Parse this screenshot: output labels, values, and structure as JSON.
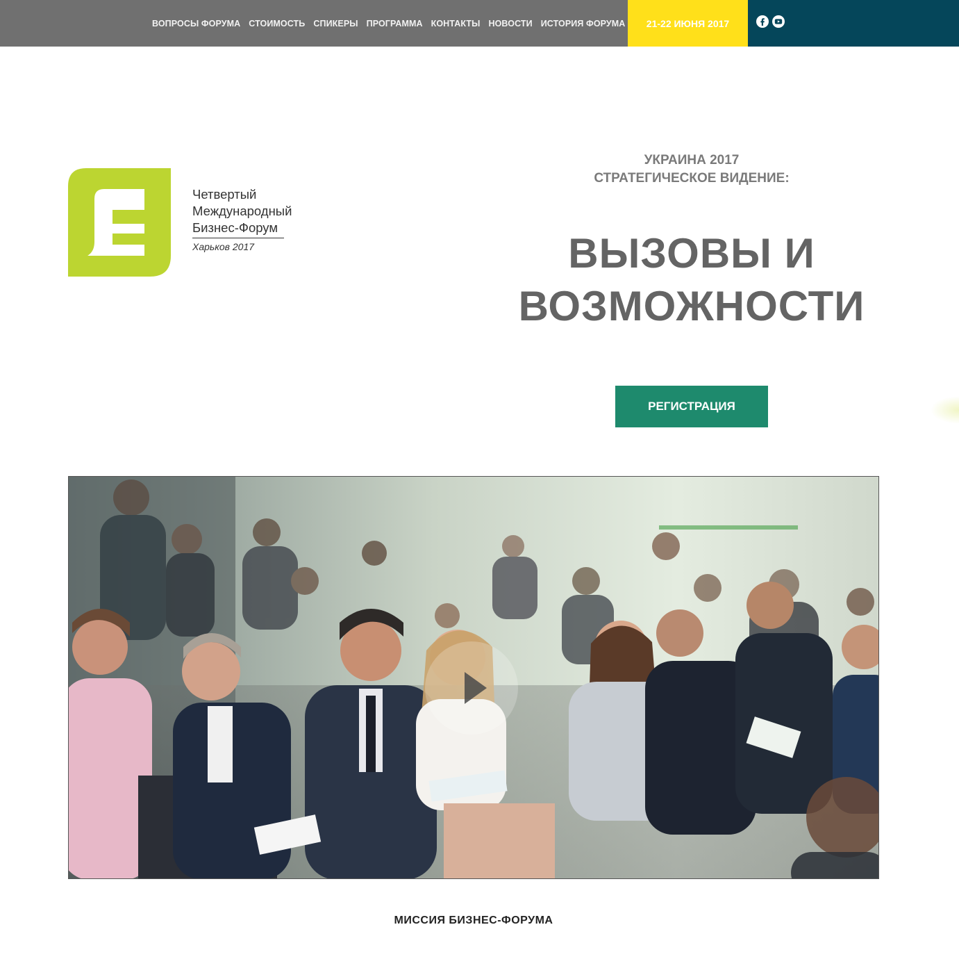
{
  "nav": {
    "items": [
      {
        "label": "ВОПРОСЫ ФОРУМА"
      },
      {
        "label": "СТОИМОСТЬ"
      },
      {
        "label": "СПИКЕРЫ"
      },
      {
        "label": "ПРОГРАММА"
      },
      {
        "label": "КОНТАКТЫ"
      },
      {
        "label": "НОВОСТИ"
      },
      {
        "label": "ИСТОРИЯ ФОРУМА"
      }
    ],
    "date": "21-22 ИЮНЯ 2017",
    "social": [
      "facebook-icon",
      "youtube-icon"
    ]
  },
  "logo": {
    "line1": "Четвертый",
    "line2": "Международный",
    "line3": "Бизнес-Форум",
    "city": "Харьков 2017"
  },
  "hero": {
    "subtitle_line1": "УКРАИНА 2017",
    "subtitle_line2": "СТРАТЕГИЧЕСКОЕ ВИДЕНИЕ:",
    "title_line1": "ВЫЗОВЫ И",
    "title_line2": "ВОЗМОЖНОСТИ",
    "register_label": "РЕГИСТРАЦИЯ"
  },
  "video": {
    "play_icon": "play-icon"
  },
  "mission": {
    "heading": "МИССИЯ БИЗНЕС-ФОРУМА"
  },
  "colors": {
    "topbar": "#707070",
    "date_bg": "#ffe01a",
    "social_bg": "#05465a",
    "logo_green": "#bcd531",
    "register_bg": "#1e8a6d",
    "title_gray": "#646464"
  }
}
